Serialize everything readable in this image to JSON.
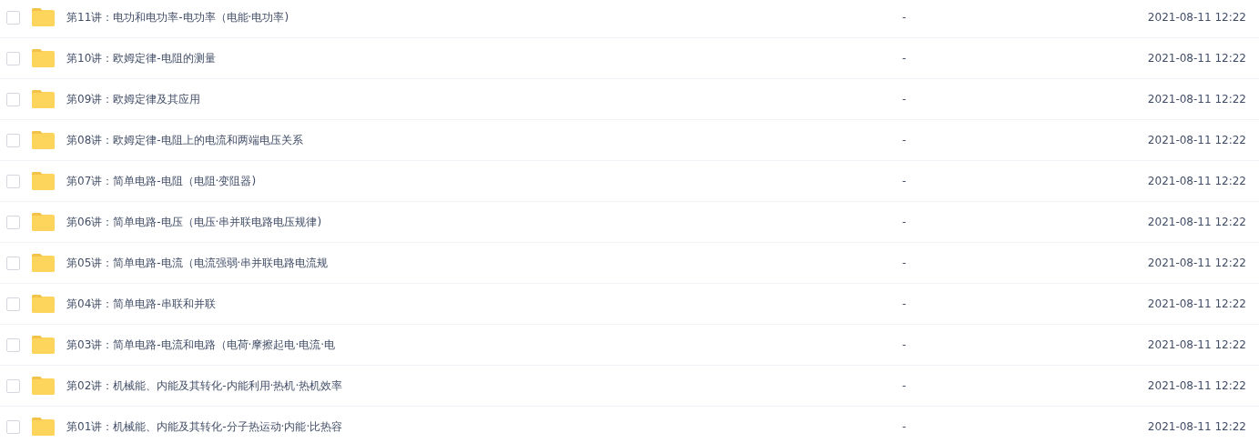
{
  "files": [
    {
      "name": "第11讲：电功和电功率-电功率（电能·电功率)",
      "size": "-",
      "modified": "2021-08-11 12:22",
      "checked": false
    },
    {
      "name": "第10讲：欧姆定律-电阻的测量",
      "size": "-",
      "modified": "2021-08-11 12:22",
      "checked": false
    },
    {
      "name": "第09讲：欧姆定律及其应用",
      "size": "-",
      "modified": "2021-08-11 12:22",
      "checked": false
    },
    {
      "name": "第08讲：欧姆定律-电阻上的电流和两端电压关系",
      "size": "-",
      "modified": "2021-08-11 12:22",
      "checked": false
    },
    {
      "name": "第07讲：简单电路-电阻（电阻·变阻器)",
      "size": "-",
      "modified": "2021-08-11 12:22",
      "checked": false
    },
    {
      "name": "第06讲：简单电路-电压（电压·串并联电路电压规律)",
      "size": "-",
      "modified": "2021-08-11 12:22",
      "checked": false
    },
    {
      "name": "第05讲：简单电路-电流（电流强弱·串并联电路电流规",
      "size": "-",
      "modified": "2021-08-11 12:22",
      "checked": false
    },
    {
      "name": "第04讲：简单电路-串联和并联",
      "size": "-",
      "modified": "2021-08-11 12:22",
      "checked": false
    },
    {
      "name": "第03讲：简单电路-电流和电路（电荷·摩擦起电·电流·电",
      "size": "-",
      "modified": "2021-08-11 12:22",
      "checked": false
    },
    {
      "name": "第02讲：机械能、内能及其转化-内能利用·热机·热机效率",
      "size": "-",
      "modified": "2021-08-11 12:22",
      "checked": false
    },
    {
      "name": "第01讲：机械能、内能及其转化-分子热运动·内能·比热容",
      "size": "-",
      "modified": "2021-08-11 12:22",
      "checked": false
    }
  ]
}
